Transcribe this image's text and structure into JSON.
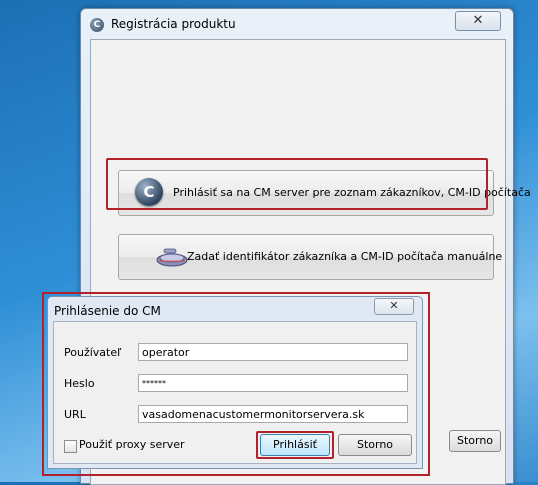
{
  "main_window": {
    "title": "Registrácia produktu",
    "close_symbol": "✕",
    "app_icon": "C",
    "buttons": {
      "cm_server_label": "Prihlásiť sa na CM server pre zoznam zákazníkov, CM-ID počítača",
      "cm_server_icon": "cm-logo-icon",
      "manual_label": "Zadať identifikátor zákazníka a CM-ID počítača manuálne",
      "manual_icon": "key-icon",
      "storno_label": "Storno"
    }
  },
  "login_dialog": {
    "title": "Prihlásenie do CM",
    "close_symbol": "✕",
    "fields": {
      "user_label": "Používateľ",
      "user_value": "operator",
      "password_label": "Heslo",
      "password_value": "******",
      "url_label": "URL",
      "url_value": "vasadomenacustomermonitorservera.sk"
    },
    "proxy_checkbox_label": "Použiť proxy server",
    "proxy_checked": false,
    "login_button": "Prihlásiť",
    "storno_button": "Storno"
  },
  "colors": {
    "highlight": "#b1222a",
    "accent": "#3c7fb1"
  }
}
